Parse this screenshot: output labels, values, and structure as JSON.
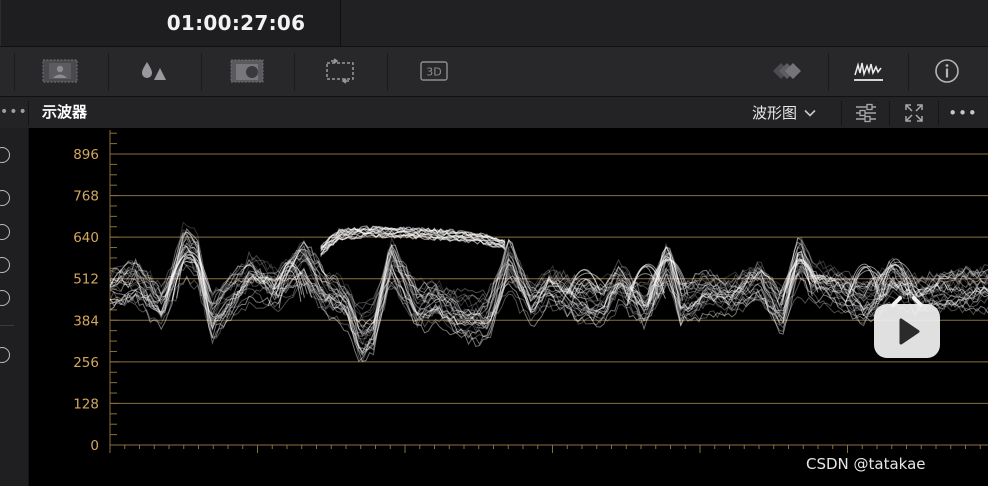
{
  "header": {
    "timecode": "01:00:27:06"
  },
  "toolbar": {
    "tools": [
      {
        "icon": "image-viewer-icon"
      },
      {
        "icon": "color-drops-icon"
      },
      {
        "icon": "texture-image-icon"
      },
      {
        "icon": "sizing-transform-icon"
      },
      {
        "icon": "3d-keyer-icon"
      },
      {
        "icon": "layers-diamond-icon"
      },
      {
        "icon": "waveform-scope-icon",
        "active": true
      },
      {
        "icon": "info-icon"
      }
    ],
    "keyer_label": "3D"
  },
  "panel": {
    "title": "示波器",
    "mode": "波形图",
    "more_left": "•••",
    "more_right": "•••"
  },
  "scope": {
    "axis_labels": [
      "896",
      "768",
      "640",
      "512",
      "384",
      "256",
      "128",
      "0"
    ],
    "axis_values": [
      896,
      768,
      640,
      512,
      384,
      256,
      128,
      0
    ],
    "ylim": [
      0,
      1023
    ],
    "trace_color": "#ffffff",
    "graticule_color": "#8a6f3e",
    "label_color": "#d3a75e"
  },
  "left_strip": {
    "radio_count": 6
  },
  "watermark": {
    "text": "CSDN @tatakae",
    "logo": "bilibili-tv-logo"
  },
  "colors": {
    "background": "#1c1c1f",
    "toolbar": "#28282b",
    "accent_gold": "#d3a75e"
  }
}
